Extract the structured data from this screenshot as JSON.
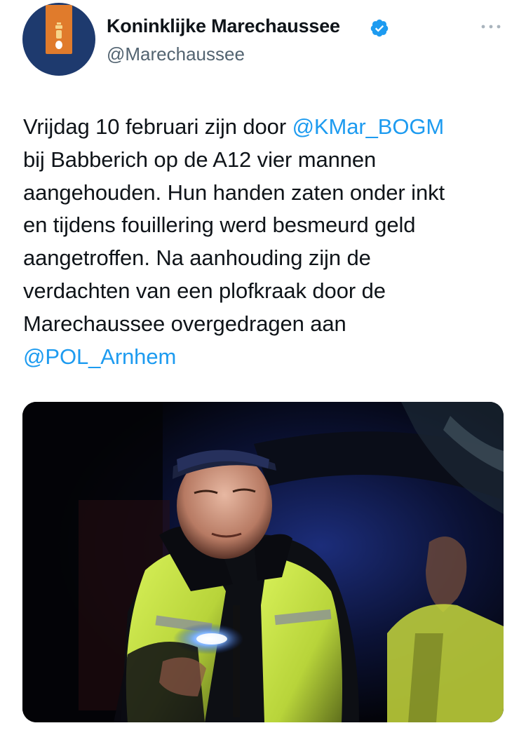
{
  "account": {
    "name": "Koninklijke Marechaussee",
    "handle": "@Marechaussee",
    "avatar_icon": "kmar-emblem-icon",
    "verified_icon": "verified-badge-icon",
    "more_icon": "more-options-icon"
  },
  "tweet": {
    "lines": [
      {
        "parts": [
          {
            "text": "Vrijdag 10 februari zijn door ",
            "mention": false
          },
          {
            "text": "@KMar_BOGM",
            "mention": true
          }
        ]
      },
      {
        "parts": [
          {
            "text": "bij Babberich op de A12 vier mannen",
            "mention": false
          }
        ]
      },
      {
        "parts": [
          {
            "text": "aangehouden. Hun handen zaten onder inkt",
            "mention": false
          }
        ]
      },
      {
        "parts": [
          {
            "text": "en tijdens fouillering  werd besmeurd geld",
            "mention": false
          }
        ]
      },
      {
        "parts": [
          {
            "text": "aangetroffen. Na aanhouding zijn de",
            "mention": false
          }
        ]
      },
      {
        "parts": [
          {
            "text": "verdachten van een plofkraak door de",
            "mention": false
          }
        ]
      },
      {
        "parts": [
          {
            "text": "Marechaussee overgedragen aan",
            "mention": false
          }
        ]
      },
      {
        "parts": [
          {
            "text": "@POL_Arnhem",
            "mention": true
          }
        ]
      }
    ]
  },
  "media": {
    "type": "photo"
  },
  "colors": {
    "mention": "#1d9bf0",
    "text": "#0f1419",
    "secondary": "#536471",
    "verified": "#1d9bf0",
    "avatar_bg": "#1e3a6e",
    "avatar_badge": "#e07b2c"
  }
}
